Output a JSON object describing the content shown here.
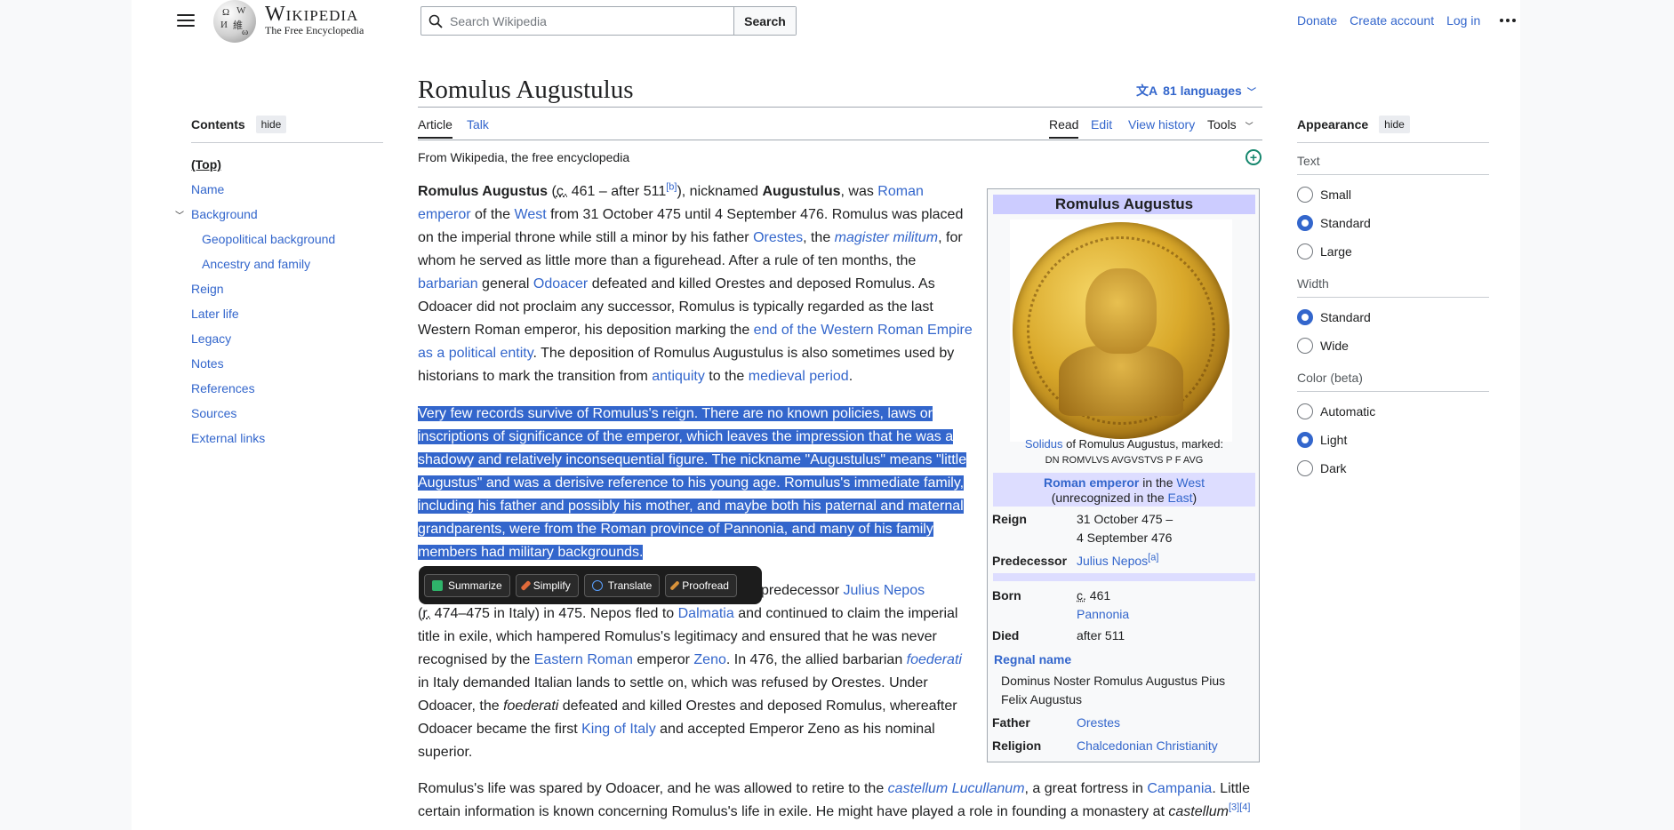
{
  "header": {
    "logo_title": "Wikipedia",
    "logo_tagline": "The Free Encyclopedia",
    "search_placeholder": "Search Wikipedia",
    "search_button": "Search",
    "links": [
      "Donate",
      "Create account",
      "Log in"
    ]
  },
  "toc": {
    "title": "Contents",
    "hide": "hide",
    "items": [
      "(Top)",
      "Name",
      "Background",
      "Geopolitical background",
      "Ancestry and family",
      "Reign",
      "Later life",
      "Legacy",
      "Notes",
      "References",
      "Sources",
      "External links"
    ]
  },
  "article": {
    "title": "Romulus Augustulus",
    "languages": "81 languages",
    "tabs": {
      "article": "Article",
      "talk": "Talk",
      "read": "Read",
      "edit": "Edit",
      "history": "View history",
      "tools": "Tools"
    },
    "from": "From Wikipedia, the free encyclopedia"
  },
  "p1": {
    "a": "Romulus Augustus",
    "b": " (",
    "c": "c.",
    "d": " 461 – after 511",
    "e": "[b]",
    "f": "), nicknamed ",
    "g": "Augustulus",
    "h": ", was ",
    "i": "Roman emperor",
    "j": " of the ",
    "k": "West",
    "l": " from 31 October 475 until 4 September 476. Romulus was placed on the imperial throne while still a minor by his father ",
    "m": "Orestes",
    "n": ", the ",
    "o": "magister militum",
    "p": ", for whom he served as little more than a figurehead. After a rule of ten months, the ",
    "q": "barbarian",
    "r": " general ",
    "s": "Odoacer",
    "t": " defeated and killed Orestes and deposed Romulus. As Odoacer did not proclaim any successor, Romulus is typically regarded as the last Western Roman emperor, his deposition marking the ",
    "u": "end of the Western Roman Empire as a political entity",
    "v": ". The deposition of Romulus Augustulus is also sometimes used by historians to mark the transition from ",
    "w": "antiquity",
    "x": " to the ",
    "y": "medieval period",
    "z": "."
  },
  "p2": "Very few records survive of Romulus's reign. There are no known policies, laws or inscriptions of significance of the emperor, which leaves the impression that he was a shadowy and relatively inconsequential figure. The nickname \"Augustulus\" means \"little Augustus\" and was a derisive reference to his young age. Romulus's immediate family, including his father and possibly his mother, and maybe both his paternal and maternal grandparents, were from the Roman province of Pannonia, and many of his family members had military backgrounds.",
  "p3": {
    "a": "predecessor ",
    "b": "Julius Nepos",
    "c": "(",
    "d": "r.",
    "e": " 474–475 in Italy) in 475. Nepos fled to ",
    "f": "Dalmatia",
    "g": " and continued to claim the imperial title in exile, which hampered Romulus's legitimacy and ensured that he was never recognised by the ",
    "h": "Eastern Roman",
    "i": " emperor ",
    "j": "Zeno",
    "k": ". In 476, the allied barbarian ",
    "l": "foederati",
    "m": " in Italy demanded Italian lands to settle on, which was refused by Orestes. Under Odoacer, the ",
    "n": "foederati",
    "o": " defeated and killed Orestes and deposed Romulus, whereafter Odoacer became the first ",
    "p": "King of Italy",
    "q": " and accepted Emperor Zeno as his nominal superior."
  },
  "p4": {
    "a": "Romulus's life was spared by Odoacer, and he was allowed to retire to the ",
    "b": "castellum Lucullanum",
    "c": ", a great fortress in ",
    "d": "Campania",
    "e": ". Little certain information is known concerning Romulus's life in exile. He might have played a role in founding a monastery at ",
    "f": "castellum",
    "g": "[3][4]"
  },
  "toolbar": [
    "Summarize",
    "Simplify",
    "Translate",
    "Proofread"
  ],
  "infobox": {
    "title": "Romulus Augustus",
    "caption_link": "Solidus",
    "caption_rest": " of Romulus Augustus, marked:",
    "legend": "DN ROMVLVS AVGVSTVS P F AVG",
    "sub_link": "Roman emperor",
    "sub_mid": " in the ",
    "sub_west": "West",
    "sub_line2a": "(unrecognized in the ",
    "sub_east": "East",
    "sub_line2b": ")",
    "reign_k": "Reign",
    "reign_v1": "31 October 475 –",
    "reign_v2": "4 September 476",
    "pred_k": "Predecessor",
    "pred_v": "Julius Nepos",
    "pred_sup": "[a]",
    "born_k": "Born",
    "born_c": "c.",
    "born_v": " 461",
    "born_place": "Pannonia",
    "died_k": "Died",
    "died_v": "after 511",
    "regnal_k": "Regnal name",
    "regnal_v": "Dominus Noster Romulus Augustus Pius Felix Augustus",
    "father_k": "Father",
    "father_v": "Orestes",
    "religion_k": "Religion",
    "religion_v": "Chalcedonian Christianity"
  },
  "appearance": {
    "title": "Appearance",
    "hide": "hide",
    "text_label": "Text",
    "text_opts": [
      "Small",
      "Standard",
      "Large"
    ],
    "text_sel": 1,
    "width_label": "Width",
    "width_opts": [
      "Standard",
      "Wide"
    ],
    "width_sel": 0,
    "color_label": "Color (beta)",
    "color_opts": [
      "Automatic",
      "Light",
      "Dark"
    ],
    "color_sel": 1
  },
  "colors": {
    "link": "#3366cc",
    "highlight": "#3366cc",
    "infobox_header": "#ccccff",
    "infobox_sub": "#ddddff"
  }
}
